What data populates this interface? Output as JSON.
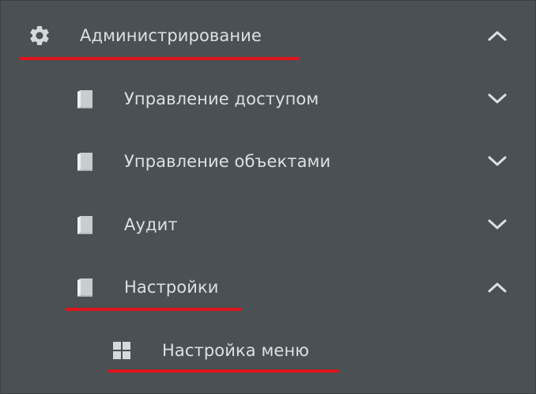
{
  "menu": {
    "root": {
      "label": "Администрирование",
      "icon": "gear-icon",
      "expanded": true
    },
    "items": [
      {
        "label": "Управление доступом",
        "icon": "book-icon",
        "expanded": false
      },
      {
        "label": "Управление объектами",
        "icon": "book-icon",
        "expanded": false
      },
      {
        "label": "Аудит",
        "icon": "book-icon",
        "expanded": false
      },
      {
        "label": "Настройки",
        "icon": "book-icon",
        "expanded": true
      }
    ],
    "subitem": {
      "label": "Настройка меню",
      "icon": "grid-icon"
    }
  },
  "colors": {
    "background": "#4a5053",
    "text": "#dde0e1",
    "icon": "#d6d9da",
    "highlight_underline": "#e0141e"
  }
}
